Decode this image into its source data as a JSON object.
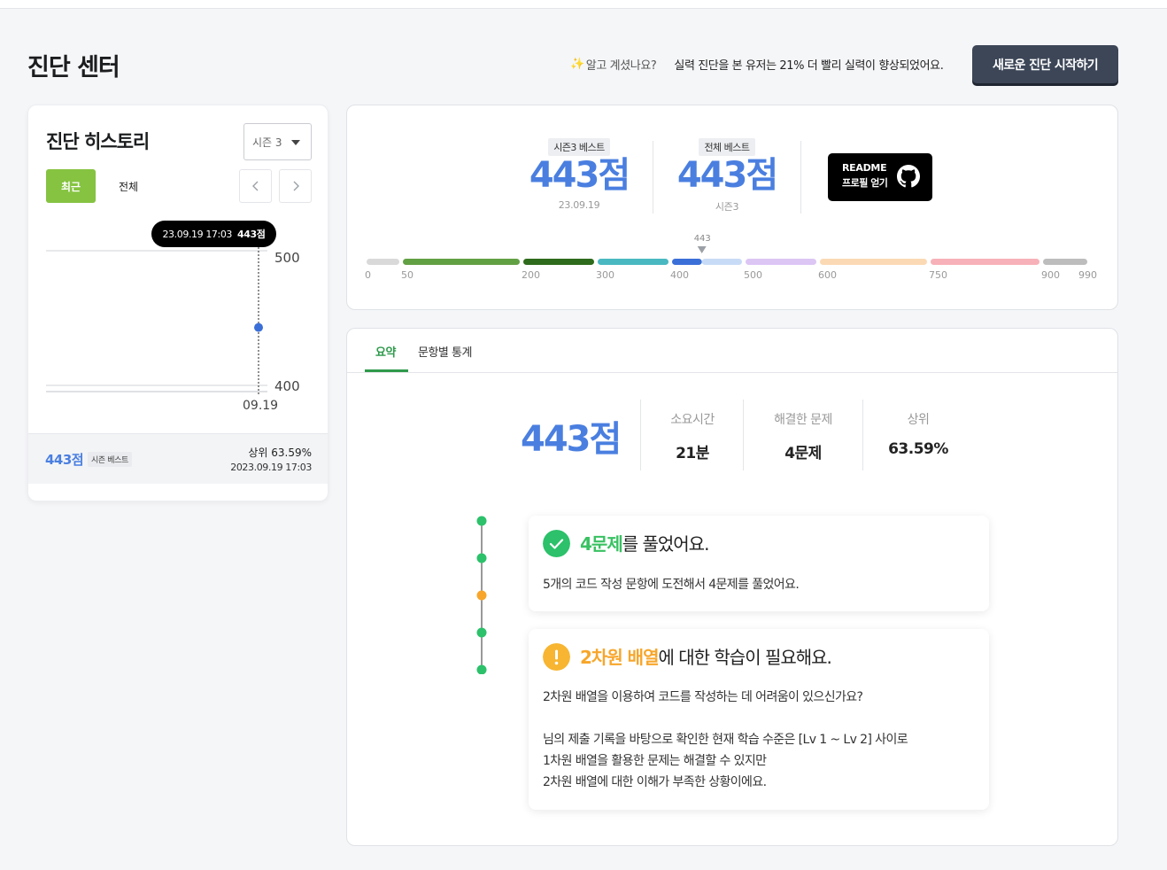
{
  "header": {
    "title": "진단 센터",
    "tip_question": "알고 계셨나요?",
    "tip_text": "실력 진단을 본 유저는 21% 더 빨리 실력이 향상되었어요.",
    "start_button": "새로운 진단 시작하기"
  },
  "history": {
    "title": "진단 히스토리",
    "season_select": "시즌 3",
    "tab_recent": "최근",
    "tab_all": "전체",
    "tooltip_date": "23.09.19 17:03",
    "tooltip_score": "443점",
    "footer_score": "443점",
    "footer_badge": "시즌 베스트",
    "footer_rank": "상위 63.59%",
    "footer_date": "2023.09.19 17:03"
  },
  "chart_data": {
    "type": "scatter",
    "x": [
      "09.19"
    ],
    "values": [
      443
    ],
    "ylim": [
      400,
      500
    ],
    "yticks": [
      "500",
      "400"
    ],
    "xticks": [
      "09.19"
    ],
    "point_color": "#3b6fd8"
  },
  "best": {
    "season_tag": "시즌3 베스트",
    "season_score": "443점",
    "season_date": "23.09.19",
    "overall_tag": "전체 베스트",
    "overall_score": "443점",
    "overall_season": "시즌3",
    "readme_line1": "README",
    "readme_line2": "프로필 얻기"
  },
  "score_bar": {
    "current": 443,
    "current_label": "443",
    "max": 990,
    "ticks": [
      0,
      50,
      200,
      300,
      400,
      500,
      600,
      750,
      900,
      990
    ],
    "segments": [
      {
        "from": 0,
        "to": 50,
        "color": "#d9d9d9"
      },
      {
        "from": 50,
        "to": 200,
        "color": "#62a044"
      },
      {
        "from": 200,
        "to": 300,
        "color": "#2e6b1c"
      },
      {
        "from": 300,
        "to": 400,
        "color": "#49b8c1"
      },
      {
        "from": 400,
        "to": 500,
        "color": "#3b6fd8",
        "light": "#c8dbf6"
      },
      {
        "from": 500,
        "to": 600,
        "color": "#dcc6f4"
      },
      {
        "from": 600,
        "to": 750,
        "color": "#fbd9b5"
      },
      {
        "from": 750,
        "to": 900,
        "color": "#f7b1b8"
      },
      {
        "from": 900,
        "to": 990,
        "color": "#bdbdbd"
      }
    ]
  },
  "summary": {
    "tab_summary": "요약",
    "tab_stats": "문항별 통계",
    "score": "443점",
    "time_label": "소요시간",
    "time_value": "21분",
    "solved_label": "해결한 문제",
    "solved_value": "4문제",
    "rank_label": "상위",
    "rank_value": "63.59%",
    "timeline_colors": [
      "#2cc16a",
      "#2cc16a",
      "#f7a62b",
      "#2cc16a",
      "#2cc16a"
    ]
  },
  "feedback": {
    "solved_highlight": "4문제",
    "solved_title_rest": "를 풀었어요.",
    "solved_body": "5개의 코드 작성 문항에 도전해서 4문제를 풀었어요.",
    "need_highlight": "2차원 배열",
    "need_title_rest": "에 대한 학습이 필요해요.",
    "need_line1": "2차원 배열을 이용하여 코드를 작성하는 데 어려움이 있으신가요?",
    "need_line2": "님의 제출 기록을 바탕으로 확인한 현재 학습 수준은 [Lv 1 ~ Lv 2] 사이로",
    "need_line3": "1차원 배열을 활용한 문제는 해결할 수 있지만",
    "need_line4": "2차원 배열에 대한 이해가 부족한 상황이에요."
  }
}
